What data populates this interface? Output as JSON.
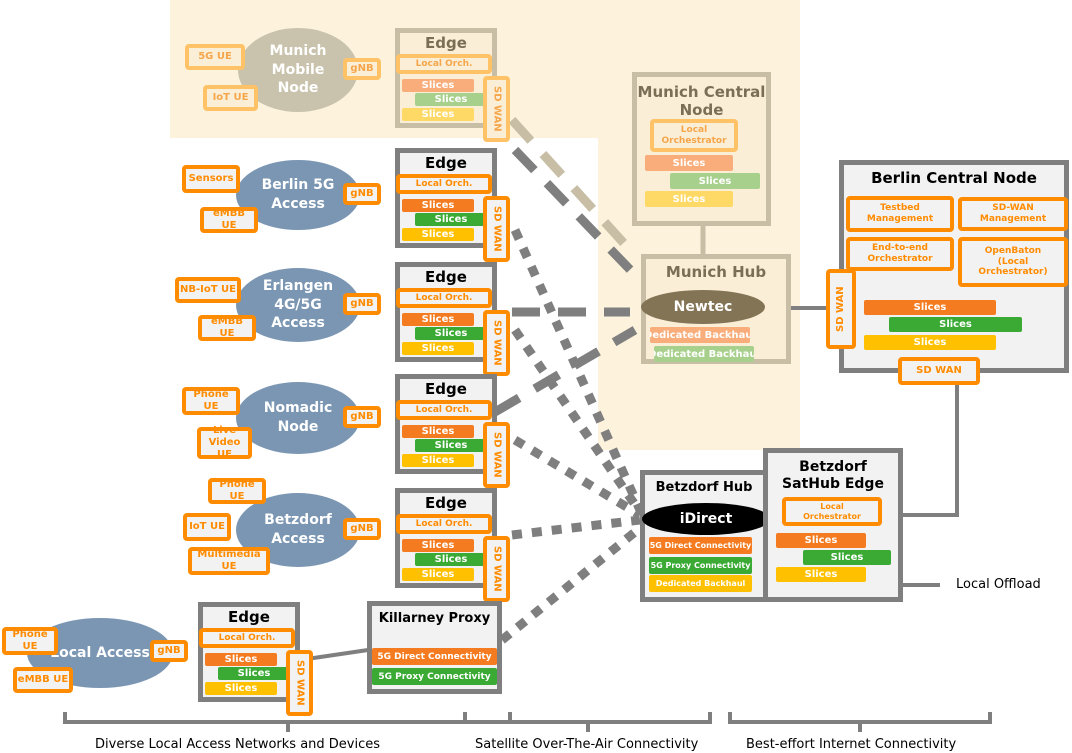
{
  "sites": [
    {
      "name": "Munich Mobile Node",
      "ues": [
        "5G UE",
        "IoT UE"
      ],
      "gnb": "gNB",
      "edge": "Edge",
      "orch": "Local Orch.",
      "slices": [
        "Slices",
        "Slices",
        "Slices"
      ],
      "sdwan": "SD WAN"
    },
    {
      "name": "Berlin 5G Access",
      "ues": [
        "Sensors",
        "eMBB UE"
      ],
      "gnb": "gNB",
      "edge": "Edge",
      "orch": "Local Orch.",
      "slices": [
        "Slices",
        "Slices",
        "Slices"
      ],
      "sdwan": "SD WAN"
    },
    {
      "name": "Erlangen 4G/5G Access",
      "ues": [
        "NB-IoT UE",
        "eMBB UE"
      ],
      "gnb": "gNB",
      "edge": "Edge",
      "orch": "Local Orch.",
      "slices": [
        "Slices",
        "Slices",
        "Slices"
      ],
      "sdwan": "SD WAN"
    },
    {
      "name": "Nomadic Node",
      "ues": [
        "Phone UE",
        "Live Video UE"
      ],
      "gnb": "gNB",
      "edge": "Edge",
      "orch": "Local Orch.",
      "slices": [
        "Slices",
        "Slices",
        "Slices"
      ],
      "sdwan": "SD WAN"
    },
    {
      "name": "Betzdorf Access",
      "ues": [
        "Phone UE",
        "IoT UE",
        "Multimedia UE"
      ],
      "gnb": "gNB",
      "edge": "Edge",
      "orch": "Local Orch.",
      "slices": [
        "Slices",
        "Slices",
        "Slices"
      ],
      "sdwan": "SD WAN"
    },
    {
      "name": "Local Access",
      "ues": [
        "Phone UE",
        "eMBB UE"
      ],
      "gnb": "gNB",
      "edge": "Edge",
      "orch": "Local Orch.",
      "slices": [
        "Slices",
        "Slices",
        "Slices"
      ],
      "sdwan": "SD WAN"
    }
  ],
  "munich_central": {
    "title": "Munich Central Node",
    "orch": "Local Orchestrator",
    "slices": [
      "Slices",
      "Slices",
      "Slices"
    ]
  },
  "munich_hub": {
    "title": "Munich Hub",
    "provider": "Newtec",
    "backhaul": [
      "Dedicated Backhaul",
      "Dedicated Backhaul"
    ]
  },
  "berlin_central": {
    "title": "Berlin Central Node",
    "modules": [
      "Testbed Management",
      "SD-WAN Management",
      "End-to-end Orchestrator",
      "OpenBaton (Local Orchestrator)"
    ],
    "slices": [
      "Slices",
      "Slices",
      "Slices"
    ],
    "sdwan_side": "SD WAN",
    "sdwan_bottom": "SD WAN"
  },
  "betzdorf_hub": {
    "title": "Betzdorf Hub",
    "provider": "iDirect",
    "services": [
      "5G Direct Connectivity",
      "5G Proxy Connectivity",
      "Dedicated Backhaul"
    ]
  },
  "betzdorf_sathub": {
    "title": "Betzdorf SatHub Edge",
    "orch": "Local Orchestrator",
    "slices": [
      "Slices",
      "Slices",
      "Slices"
    ]
  },
  "killarney": {
    "title": "Killarney Proxy",
    "services": [
      "5G Direct Connectivity",
      "5G Proxy Connectivity"
    ]
  },
  "local_offload": "Local Offload",
  "sections": [
    "Diverse Local Access Networks and Devices",
    "Satellite Over-The-Air Connectivity",
    "Best-effort Internet Connectivity"
  ],
  "colors": {
    "accent": "#ff8c00",
    "slice1": "#f47b20",
    "slice2": "#3aaa35",
    "slice3": "#ffc000",
    "box_border": "#7f7f7f",
    "access_ellipse": "#7b96b3",
    "munich_tint": "#fdf3dc"
  }
}
